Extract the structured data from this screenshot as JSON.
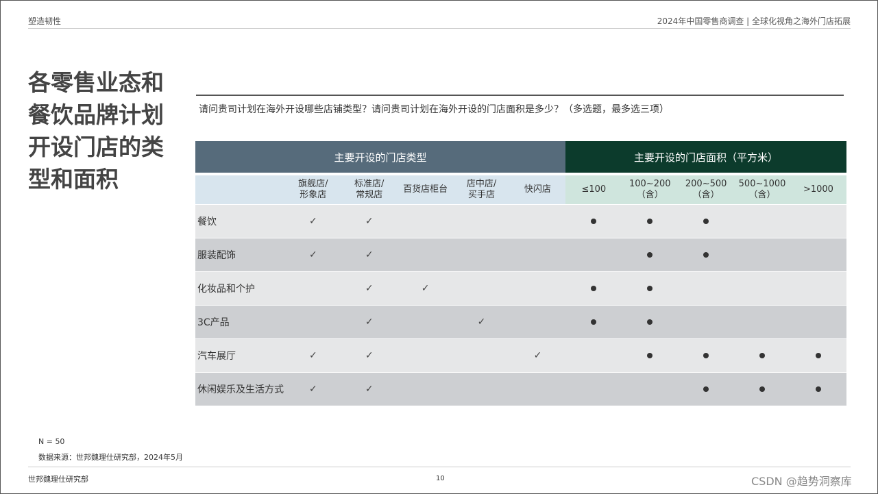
{
  "header": {
    "left": "塑造韧性",
    "right": "2024年中国零售商调查 | 全球化视角之海外门店拓展"
  },
  "title_lines": [
    "各零售业态和",
    "餐饮品牌计划",
    "开设门店的类",
    "型和面积"
  ],
  "question": "请问贵司计划在海外开设哪些店铺类型？请问贵司计划在海外开设的门店面积是多少？（多选题，最多选三项）",
  "table": {
    "group_store_type": "主要开设的门店类型",
    "group_store_area": "主要开设的门店面积（平方米）",
    "store_type_columns": [
      "旗舰店/\n形象店",
      "标准店/\n常规店",
      "百货店柜台",
      "店中店/\n买手店",
      "快闪店"
    ],
    "store_area_columns": [
      "≤100",
      "100~200\n（含）",
      "200~500\n（含）",
      "500~1000\n（含）",
      ">1000"
    ],
    "check_symbol": "✓",
    "rows": [
      {
        "label": "餐饮",
        "types": [
          true,
          true,
          false,
          false,
          false
        ],
        "areas": [
          true,
          true,
          true,
          false,
          false
        ]
      },
      {
        "label": "服装配饰",
        "types": [
          true,
          true,
          false,
          false,
          false
        ],
        "areas": [
          false,
          true,
          true,
          false,
          false
        ]
      },
      {
        "label": "化妆品和个护",
        "types": [
          false,
          true,
          true,
          false,
          false
        ],
        "areas": [
          true,
          true,
          false,
          false,
          false
        ]
      },
      {
        "label": "3C产品",
        "types": [
          false,
          true,
          false,
          true,
          false
        ],
        "areas": [
          true,
          true,
          false,
          false,
          false
        ]
      },
      {
        "label": "汽车展厅",
        "types": [
          true,
          true,
          false,
          false,
          true
        ],
        "areas": [
          false,
          true,
          true,
          true,
          true
        ]
      },
      {
        "label": "休闲娱乐及生活方式",
        "types": [
          true,
          true,
          false,
          false,
          false
        ],
        "areas": [
          false,
          false,
          true,
          true,
          true
        ]
      }
    ]
  },
  "footnotes": {
    "sample": "N = 50",
    "source": "数据来源：世邦魏理仕研究部，2024年5月"
  },
  "footer": {
    "org": "世邦魏理仕研究部",
    "page": "10",
    "watermark": "CSDN @趋势洞察库"
  },
  "colors": {
    "store_type_header": "#566b7b",
    "store_area_header": "#0c3b2c",
    "store_type_subheader": "#d8e5ee",
    "store_area_subheader": "#cfe5dd",
    "row_light": "#e6e7e8",
    "row_dark": "#cdcfd2"
  }
}
